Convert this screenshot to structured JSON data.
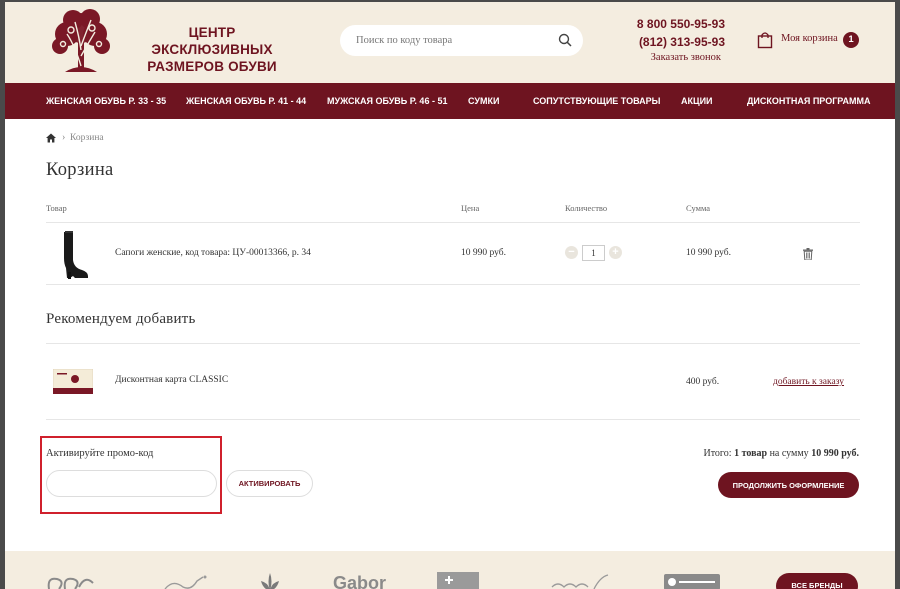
{
  "header": {
    "logo_line1": "ЦЕНТР ЭКСКЛЮЗИВНЫХ",
    "logo_line2": "РАЗМЕРОВ ОБУВИ",
    "search_placeholder": "Поиск по коду товара",
    "phone1": "8 800 550-95-93",
    "phone2": "(812) 313-95-93",
    "callback": "Заказать звонок",
    "cart_label": "Моя корзина",
    "cart_count": "1",
    "brand_color": "#6e1420",
    "header_bg": "#f4ede0"
  },
  "nav": [
    "ЖЕНСКАЯ ОБУВЬ Р. 33 - 35",
    "ЖЕНСКАЯ ОБУВЬ Р. 41 - 44",
    "МУЖСКАЯ ОБУВЬ Р. 46 - 51",
    "СУМКИ",
    "СОПУТСТВУЮЩИЕ ТОВАРЫ",
    "АКЦИИ",
    "ДИСКОНТНАЯ ПРОГРАММА"
  ],
  "breadcrumb": {
    "current": "Корзина"
  },
  "page_title": "Корзина",
  "table": {
    "headers": [
      "Товар",
      "Цена",
      "Количество",
      "Сумма"
    ],
    "item": {
      "name": "Сапоги женские, код товара: ЦУ-00013366, р. 34",
      "price": "10 990 руб.",
      "qty": "1",
      "sum": "10 990 руб."
    }
  },
  "recommend": {
    "title": "Рекомендуем добавить",
    "item_name": "Дисконтная карта CLASSIC",
    "item_price": "400 руб.",
    "add_link": "добавить к заказу"
  },
  "promo": {
    "label": "Активируйте промо-код",
    "value": "",
    "button": "АКТИВИРОВАТЬ"
  },
  "summary": {
    "prefix": "Итого:",
    "count": "1 товар",
    "middle": "на сумму",
    "amount": "10 990 руб.",
    "checkout": "ПРОДОЛЖИТЬ ОФОРМЛЕНИЕ"
  },
  "footer": {
    "brands": [
      "Gabor"
    ],
    "all_brands": "ВСЕ БРЕНДЫ"
  }
}
